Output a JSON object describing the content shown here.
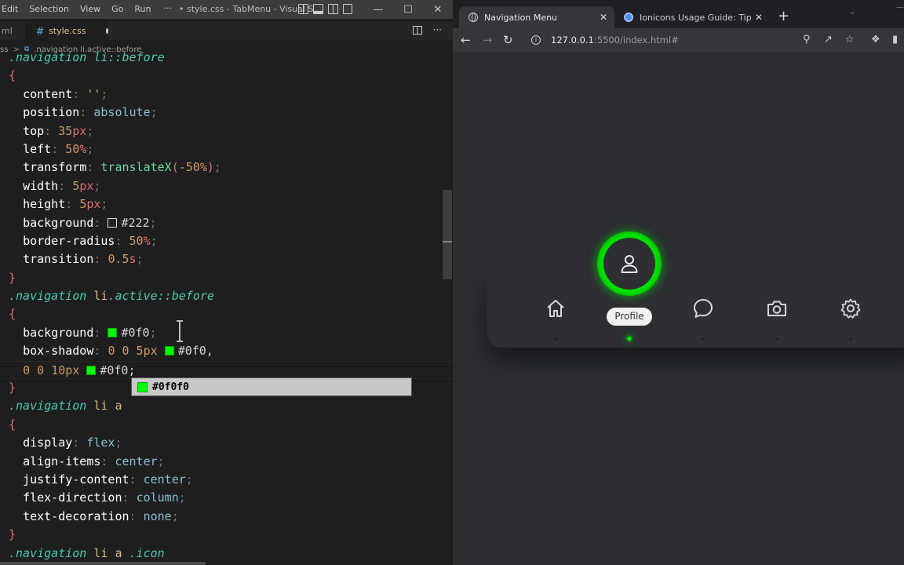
{
  "vscode": {
    "menu": [
      "Edit",
      "Selection",
      "View",
      "Go",
      "Run",
      "···"
    ],
    "window_title": "• style.css - TabMenu - Visual S...",
    "tab_prev": "ml",
    "tab_active": "style.css",
    "breadcrumb_prefix": "ss",
    "breadcrumb_sep": ">",
    "breadcrumb_item": ".navigation li.active::before",
    "suggestion": "#0f0f0",
    "code": {
      "l0_sel": ".navigation li::before",
      "l2_prop": "content",
      "l2_val": "''",
      "l3_prop": "position",
      "l3_val": "absolute",
      "l4_prop": "top",
      "l4_num": "35",
      "l4_unit": "px",
      "l5_prop": "left",
      "l5_num": "50",
      "l5_unit": "%",
      "l6_prop": "transform",
      "l6_func": "translateX",
      "l6_arg": "-50%",
      "l7_prop": "width",
      "l7_num": "5",
      "l7_unit": "px",
      "l8_prop": "height",
      "l8_num": "5",
      "l8_unit": "px",
      "l9_prop": "background",
      "l9_val": "#222",
      "l10_prop": "border-radius",
      "l10_num": "50",
      "l10_unit": "%",
      "l11_prop": "transition",
      "l11_num": "0.5",
      "l11_unit": "s",
      "l13_sel_a": ".navigation",
      "l13_sel_b": "li",
      "l13_sel_c": ".active",
      "l13_sel_d": "::before",
      "l15_prop": "background",
      "l15_val": "#0f0",
      "l16_prop": "box-shadow",
      "l16_val": "0 0 5px",
      "l16_color": "#0f0,",
      "l17_val": "0 0 10px",
      "l17_color": "#0f0;",
      "l19_sel_a": ".navigation",
      "l19_sel_b": "li",
      "l19_sel_c": "a",
      "l21_prop": "display",
      "l21_val": "flex",
      "l22_prop": "align-items",
      "l22_val": "center",
      "l23_prop": "justify-content",
      "l23_val": "center",
      "l24_prop": "flex-direction",
      "l24_val": "column",
      "l25_prop": "text-decoration",
      "l25_val": "none",
      "l27_sel_a": ".navigation",
      "l27_sel_b": "li",
      "l27_sel_c": "a",
      "l27_sel_d": ".icon"
    }
  },
  "browser": {
    "tab1_title": "Navigation Menu",
    "tab2_title": "Ionicons Usage Guide: Tips for in",
    "url_host": "127.0.0.1",
    "url_rest": ":5500/index.html#",
    "nav_items": [
      {
        "icon": "home-icon"
      },
      {
        "icon": "person-icon",
        "label": "Profile",
        "active": true
      },
      {
        "icon": "chat-bubble-icon"
      },
      {
        "icon": "camera-icon"
      },
      {
        "icon": "settings-icon"
      }
    ],
    "active_label": "Profile",
    "accent": "#00ff00"
  }
}
